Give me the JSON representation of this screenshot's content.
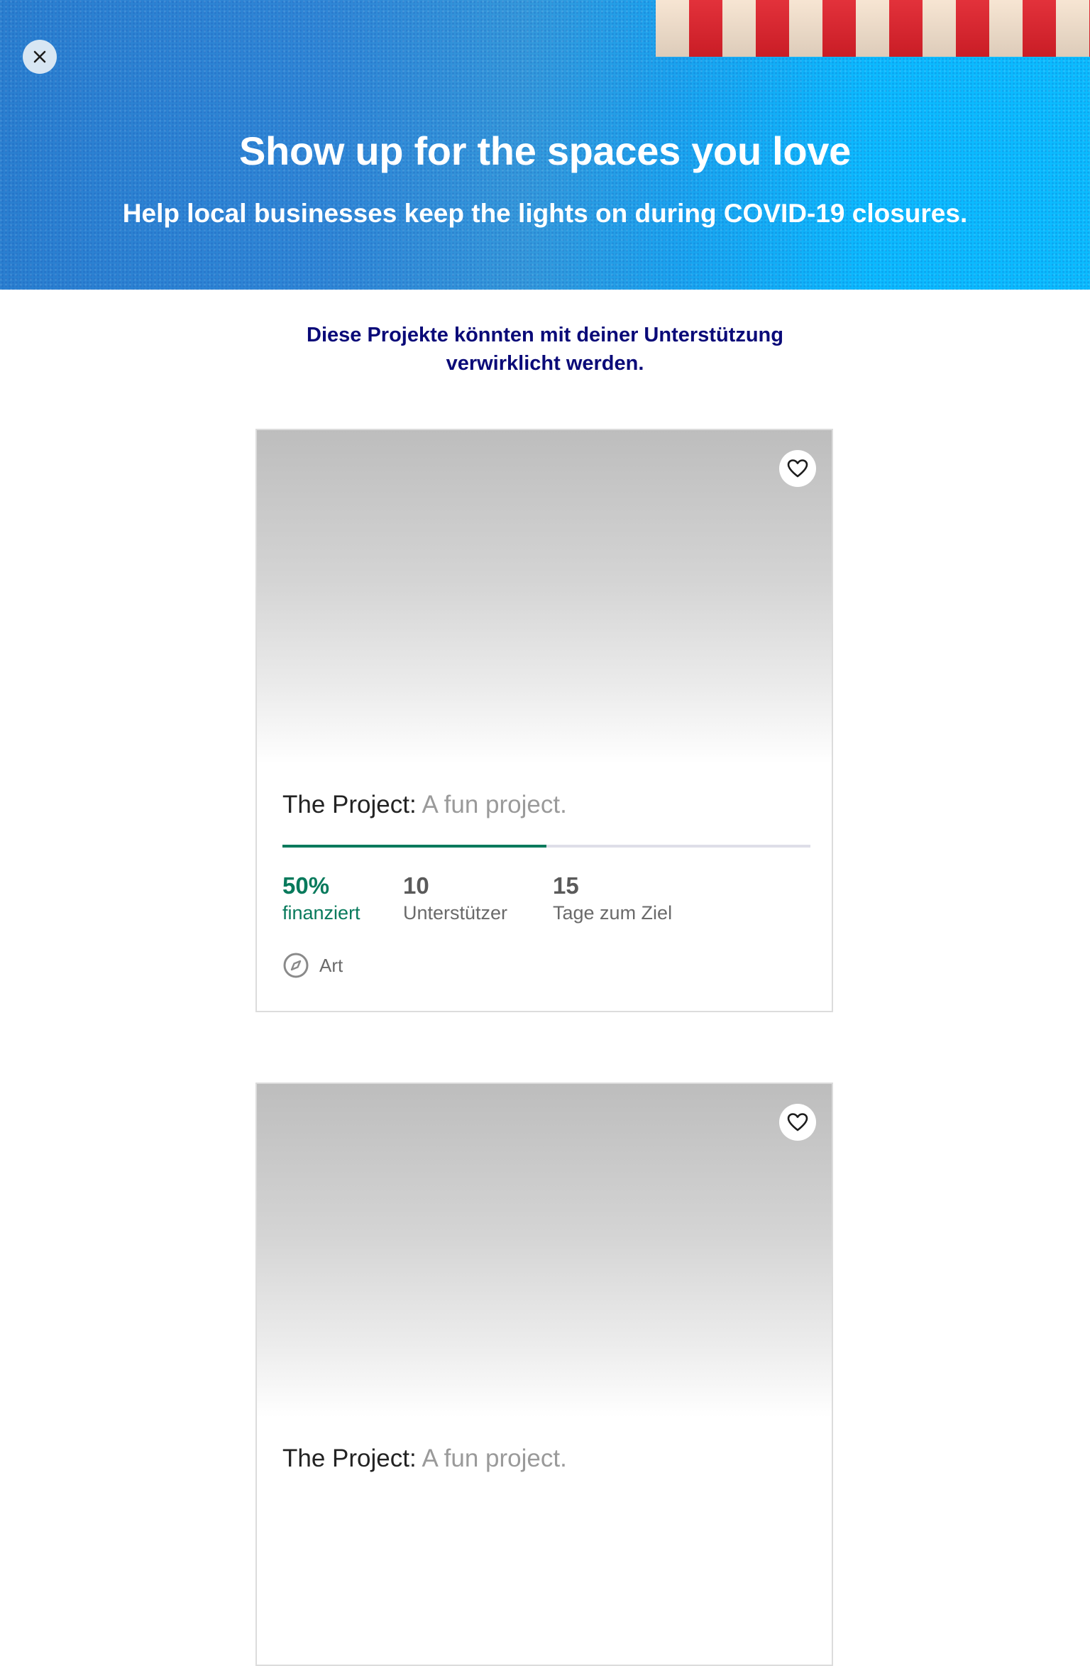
{
  "banner": {
    "title": "Show up for the spaces you love",
    "subtitle": "Help local businesses keep the lights on during COVID-19 closures.",
    "colors": {
      "left": "#2a7fd0",
      "right": "#0bbcff",
      "awning_red": "#e0202a",
      "awning_cream": "#f6e3cf"
    },
    "close_icon": "close-icon"
  },
  "intro": {
    "line1": "Diese Projekte könnten mit deiner Unterstützung",
    "line2": "verwirklicht werden."
  },
  "projects": [
    {
      "name": "The Project:",
      "blurb": " A fun project.",
      "progress": 0.5,
      "funded_value": "50%",
      "funded_label": "finanziert",
      "backers_value": "10",
      "backers_label": "Unterstützer",
      "days_value": "15",
      "days_label": "Tage zum Ziel",
      "category": "Art",
      "favorite_icon": "heart-icon",
      "category_icon": "compass-icon"
    },
    {
      "name": "The Project:",
      "blurb": " A fun project.",
      "favorite_icon": "heart-icon"
    }
  ],
  "accent_color": "#087a5c",
  "intro_color": "#0a0a78"
}
